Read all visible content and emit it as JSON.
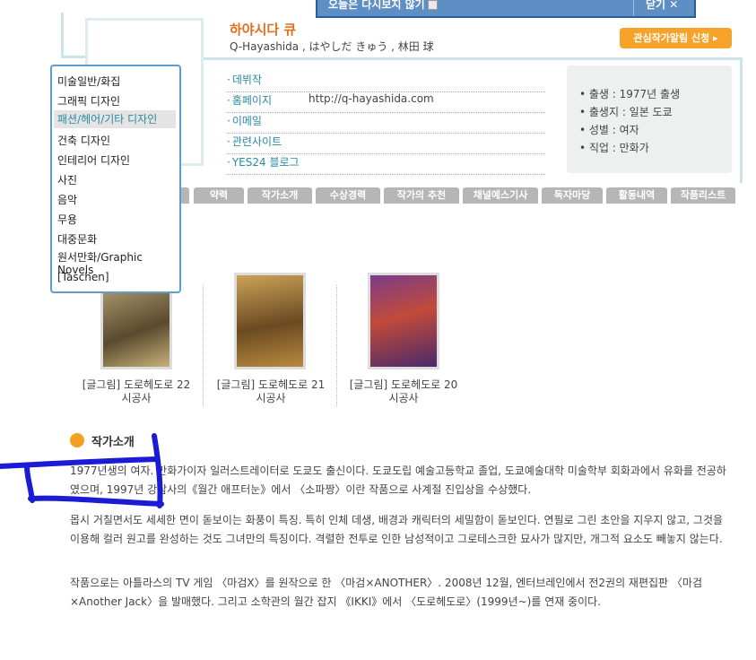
{
  "popup": {
    "text": "오늘은 다시보지 않기",
    "close": "닫기 ✕"
  },
  "author": {
    "name": "하야시다 큐",
    "subname": "Q-Hayashida , はやしだ きゅう , 林田 球",
    "alarm_button": "관심작가알림 신청 ▸"
  },
  "links": [
    {
      "label": "데뷔작",
      "value": ""
    },
    {
      "label": "홈페이지",
      "value": "http://q-hayashida.com"
    },
    {
      "label": "이메일",
      "value": ""
    },
    {
      "label": "관련사이트",
      "value": ""
    },
    {
      "label": "YES24 블로그",
      "value": ""
    }
  ],
  "info": [
    "• 출생 : 1977년 출생",
    "• 출생지 : 일본 도쿄",
    "• 성별 : 여자",
    "• 직업 : 만화가"
  ],
  "tabs": [
    "약력",
    "작가소개",
    "수상경력",
    "작가의 추천",
    "채널예스기사",
    "독자마당",
    "활동내역",
    "작품리스트"
  ],
  "menu": [
    "미술일반/화집",
    "그래픽 디자인",
    "패션/헤어/기타 디자인",
    "건축 디자인",
    "인테리어 디자인",
    "사진",
    "음악",
    "무용",
    "대중문화",
    "원서만화/Graphic Novels",
    "[Taschen]"
  ],
  "books": [
    {
      "title": "[글그림] 도로헤도로 22",
      "publisher": "시공사",
      "color": "#8a7a55"
    },
    {
      "title": "[글그림] 도로헤도로 21",
      "publisher": "시공사",
      "color": "#a88640"
    },
    {
      "title": "[글그림] 도로헤도로 20",
      "publisher": "시공사",
      "color": "#6d3a7a"
    }
  ],
  "intro": {
    "title": "작가소개",
    "p1": "1977년생의 여자. 만화가이자 일러스트레이터로 도쿄도 출신이다. 도쿄도립 예술고등학교 졸업, 도쿄예술대학 미술학부 회화과에서 유화를 전공하였으며, 1997년 강담사의《월간 애프터눈》에서 〈소파짱〉이란 작품으로 사계절 진입상을 수상했다.",
    "p2": "몹시 거칠면서도 세세한 면이 돋보이는 화풍이 특징. 특히 인체 데생, 배경과 캐릭터의 세밀함이 돋보인다. 연필로 그린 초안을 지우지 않고, 그것을 이용해 컬러 원고를 완성하는 것도 그녀만의 특징이다. 격렬한 전투로 인한 남성적이고 그로테스크한 묘사가 많지만, 개그적 요소도 빼놓지 않는다.",
    "p3": "작품으로는 아틀라스의 TV 게임 〈마검X〉를 원작으로 한 〈마검×ANOTHER〉. 2008년 12월, 엔터브레인에서 전2권의 재편집판 〈마검×Another Jack〉을 발매했다. 그리고 소학관의 월간 잡지 《IKKI》에서 〈도로헤도로〉(1999년~)를 연재 중이다."
  }
}
